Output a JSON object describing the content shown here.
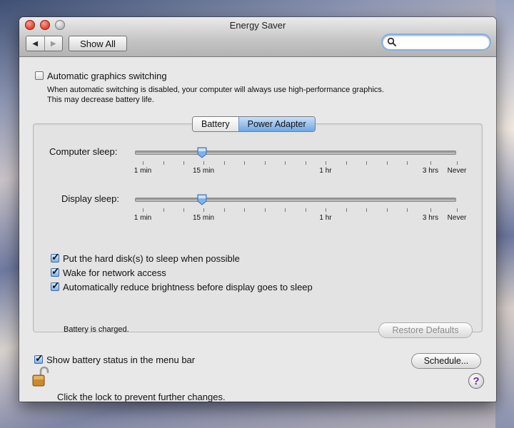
{
  "window": {
    "title": "Energy Saver"
  },
  "toolbar": {
    "back_glyph": "◀",
    "forward_glyph": "▶",
    "show_all_label": "Show All",
    "search_placeholder": ""
  },
  "graphics": {
    "checkbox_label": "Automatic graphics switching",
    "checked": false,
    "description_line1": "When automatic switching is disabled, your computer will always use high-performance graphics.",
    "description_line2": "This may decrease battery life."
  },
  "tabs": [
    {
      "label": "Battery",
      "active": false
    },
    {
      "label": "Power Adapter",
      "active": true
    }
  ],
  "sliders": {
    "computer_sleep": {
      "label": "Computer sleep:",
      "value": "15 min"
    },
    "display_sleep": {
      "label": "Display sleep:",
      "value": "15 min"
    },
    "tick_labels": [
      "1 min",
      "15 min",
      "1 hr",
      "3 hrs",
      "Never"
    ]
  },
  "options": [
    {
      "label": "Put the hard disk(s) to sleep when possible",
      "checked": true
    },
    {
      "label": "Wake for network access",
      "checked": true
    },
    {
      "label": "Automatically reduce brightness before display goes to sleep",
      "checked": true
    }
  ],
  "status": {
    "text": "Battery is charged.",
    "restore_label": "Restore Defaults"
  },
  "menu_bar_option": {
    "label": "Show battery status in the menu bar",
    "checked": true
  },
  "schedule_label": "Schedule...",
  "lock_text": "Click the lock to prevent further changes.",
  "help_glyph": "?",
  "check_glyph": "✓",
  "icons": {
    "search": "search-icon",
    "lock": "lock-icon",
    "help": "help-icon"
  },
  "colors": {
    "accent": "#6fa6e3",
    "help_purple": "#6a2bb0"
  }
}
